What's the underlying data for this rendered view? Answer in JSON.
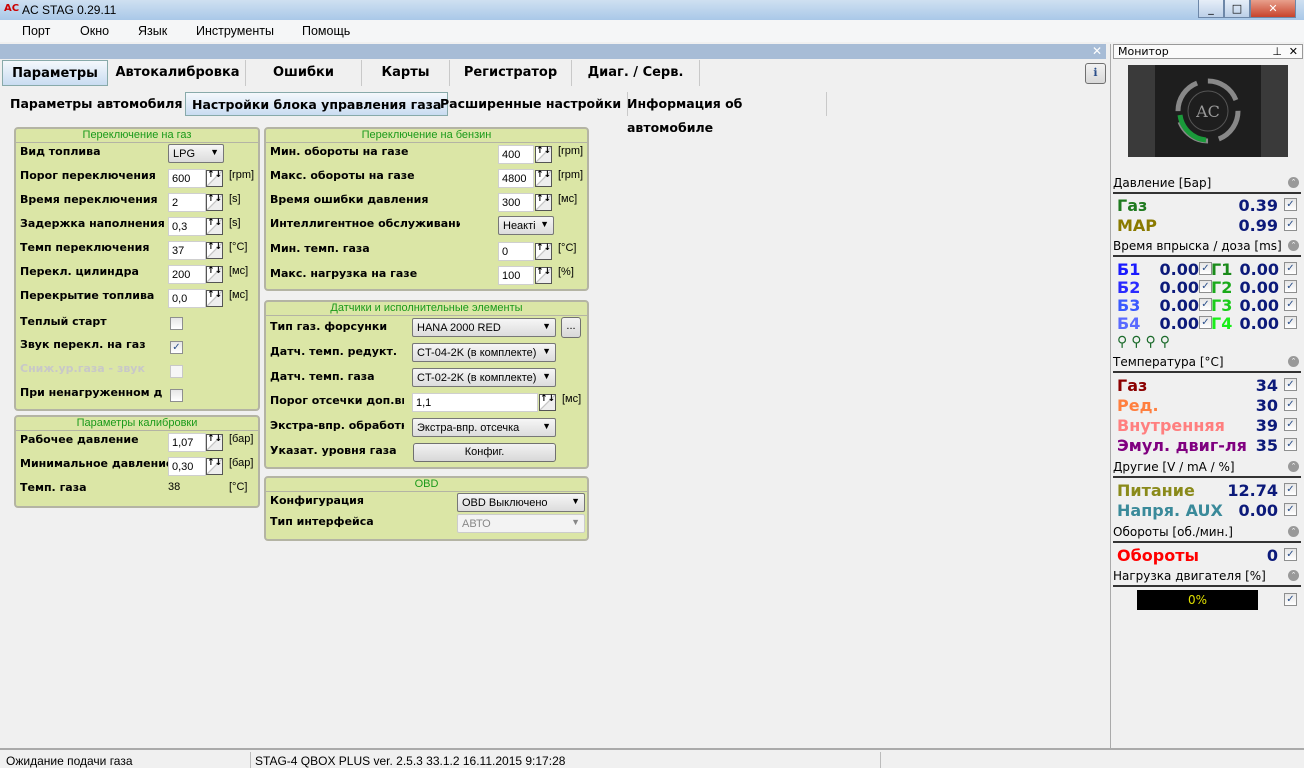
{
  "window": {
    "title": "AC STAG 0.29.11",
    "controls": [
      "_",
      "□",
      "✕"
    ]
  },
  "menu": [
    "Порт",
    "Окно",
    "Язык",
    "Инструменты",
    "Помощь"
  ],
  "main_tabs": [
    "Параметры",
    "Автокалибровка",
    "Ошибки",
    "Карты",
    "Регистратор",
    "Диаг. / Серв."
  ],
  "sub_tabs": [
    "Параметры автомобиля",
    "Настройки блока управления газа",
    "Расширенные настройки",
    "Информация об автомобиле"
  ],
  "switch_to_gas": {
    "title": "Переключение на газ",
    "fuel_type": {
      "label": "Вид топлива",
      "value": "LPG"
    },
    "rows": [
      {
        "label": "Порог переключения",
        "value": "600",
        "unit": "[rpm]"
      },
      {
        "label": "Время переключения",
        "value": "2",
        "unit": "[s]"
      },
      {
        "label": "Задержка наполнения",
        "value": "0,3",
        "unit": "[s]"
      },
      {
        "label": "Темп переключения",
        "value": "37",
        "unit": "[°C]"
      },
      {
        "label": "Перекл. цилиндра",
        "value": "200",
        "unit": "[мс]"
      },
      {
        "label": "Перекрытие топлива",
        "value": "0,0",
        "unit": "[мс]"
      }
    ],
    "checks": [
      {
        "label": "Теплый старт",
        "checked": false
      },
      {
        "label": "Звук перекл. на газ",
        "checked": true
      },
      {
        "label": "Сниж.ур.газа - звук",
        "checked": false,
        "disabled": true
      },
      {
        "label": "При ненагруженном дви",
        "checked": false
      }
    ]
  },
  "calibration": {
    "title": "Параметры калибровки",
    "rows": [
      {
        "label": "Рабочее давление",
        "value": "1,07",
        "unit": "[бар]"
      },
      {
        "label": "Минимальное давление",
        "value": "0,30",
        "unit": "[бар]"
      }
    ],
    "gas_temp": {
      "label": "Темп. газа",
      "value": "38",
      "unit": "[°C]"
    }
  },
  "switch_to_petrol": {
    "title": "Переключение на бензин",
    "rows": [
      {
        "label": "Мин. обороты на газе",
        "value": "400",
        "unit": "[rpm]"
      },
      {
        "label": "Макс. обороты на газе",
        "value": "4800",
        "unit": "[rpm]"
      },
      {
        "label": "Время ошибки давления",
        "value": "300",
        "unit": "[мс]"
      }
    ],
    "smart_service": {
      "label": "Интеллигентное обслуживание і",
      "value": "Неакті"
    },
    "rows2": [
      {
        "label": "Мин. темп. газа",
        "value": "0",
        "unit": "[°C]"
      },
      {
        "label": "Макс. нагрузка на газе",
        "value": "100",
        "unit": "[%]"
      }
    ]
  },
  "sensors": {
    "title": "Датчики и исполнительные элементы",
    "injector": {
      "label": "Тип газ. форсунки",
      "value": "HANA 2000 RED",
      "more": "..."
    },
    "reducer_temp": {
      "label": "Датч. темп. редукт.",
      "value": "CT-04-2K (в комплекте)"
    },
    "gas_temp": {
      "label": "Датч. темп. газа",
      "value": "CT-02-2K (в комплекте)"
    },
    "cutoff": {
      "label": "Порог отсечки доп.впр",
      "value": "1,1",
      "unit": "[мс]"
    },
    "extra": {
      "label": "Экстра-впр. обработка",
      "value": "Экстра-впр. отсечка"
    },
    "level": {
      "label": "Указат. уровня газа",
      "button": "Конфиг."
    }
  },
  "obd": {
    "title": "OBD",
    "config": {
      "label": "Конфигурация",
      "value": "OBD Выключено"
    },
    "iface": {
      "label": "Тип интерфейса",
      "value": "АВТО"
    }
  },
  "monitor": {
    "title": "Монитор",
    "pressure": {
      "header": "Давление [Бар]",
      "rows": [
        {
          "label": "Газ",
          "value": "0.39",
          "color": "#1f7a1f"
        },
        {
          "label": "MAP",
          "value": "0.99",
          "color": "#8a7a00"
        }
      ]
    },
    "injection": {
      "header": "Время впрыска / доза [ms]",
      "petrol": [
        {
          "label": "Б1",
          "value": "0.00",
          "color": "#1a1aff"
        },
        {
          "label": "Б2",
          "value": "0.00",
          "color": "#2a2aff"
        },
        {
          "label": "Б3",
          "value": "0.00",
          "color": "#3a5aff"
        },
        {
          "label": "Б4",
          "value": "0.00",
          "color": "#5a6aff"
        }
      ],
      "gas": [
        {
          "label": "Г1",
          "value": "0.00",
          "color": "#1a8a1a"
        },
        {
          "label": "Г2",
          "value": "0.00",
          "color": "#1aaa1a"
        },
        {
          "label": "Г3",
          "value": "0.00",
          "color": "#1acc1a"
        },
        {
          "label": "Г4",
          "value": "0.00",
          "color": "#1aee1a"
        }
      ]
    },
    "temperature": {
      "header": "Температура [°C]",
      "rows": [
        {
          "label": "Газ",
          "value": "34",
          "color": "#8b0000"
        },
        {
          "label": "Ред.",
          "value": "30",
          "color": "#ff7f3f"
        },
        {
          "label": "Внутренняя",
          "value": "39",
          "color": "#ff7f7f"
        },
        {
          "label": "Эмул. двиг-ля",
          "value": "35",
          "color": "#800080"
        }
      ]
    },
    "other": {
      "header": "Другие [V / mA / %]",
      "rows": [
        {
          "label": "Питание",
          "value": "12.74",
          "color": "#8a8a1a"
        },
        {
          "label": "Напря. AUX",
          "value": "0.00",
          "color": "#3a8a9a"
        }
      ]
    },
    "rpm": {
      "header": "Обороты [об./мин.]",
      "rows": [
        {
          "label": "Обороты",
          "value": "0",
          "color": "#ff0000"
        }
      ]
    },
    "load": {
      "header": "Нагрузка двигателя [%]",
      "value": "0%",
      "percent": 0
    }
  },
  "status": {
    "message": "Ожидание подачи газа",
    "device": "STAG-4 QBOX PLUS  ver. 2.5.3  33.1.2   16.11.2015 9:17:28"
  }
}
